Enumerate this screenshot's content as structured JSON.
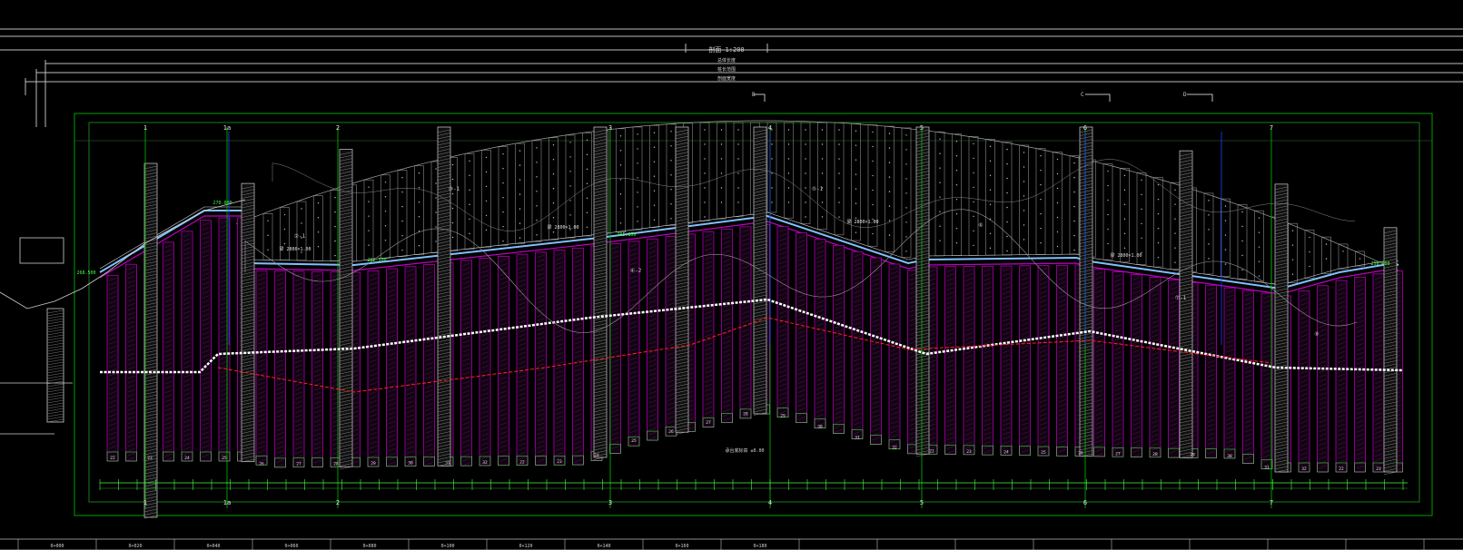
{
  "drawing": {
    "title": "剖面 1:200",
    "scale_marks": [
      "总体长度",
      "桩长范围",
      "剖面宽度"
    ],
    "section_marks": [
      "B",
      "C",
      "D"
    ],
    "grid_labels": [
      "1",
      "1a",
      "2",
      "3",
      "4",
      "5",
      "6",
      "7"
    ],
    "layer_tags": [
      "②-1",
      "③-1",
      "④-2",
      "⑤-1",
      "⑥",
      "⑦-1",
      "⑨"
    ],
    "elevation_tags": [
      "270.000",
      "262.300",
      "265.850",
      "258.000",
      "268.500"
    ],
    "beam_tags": [
      "梁 2800×1.00",
      "梁 2800×1.00",
      "梁 2800×1.00",
      "梁 2800×1.00"
    ],
    "bottom_note": "承台底标高 ±0.00",
    "station_marks": [
      "0+000",
      "0+020",
      "0+040",
      "0+060",
      "0+080",
      "0+100",
      "0+120",
      "0+140",
      "0+160",
      "0+180"
    ],
    "pile_numbers": [
      "22",
      "23",
      "24",
      "25",
      "26",
      "27",
      "28",
      "29",
      "30",
      "31",
      "32"
    ]
  },
  "colors": {
    "background": "#000000",
    "lines": "#d0d0d0",
    "frame_green": "#00c000",
    "pile_magenta": "#c000c0",
    "cap_cyan": "#80c0ff",
    "dim_green": "#40ff40",
    "red_line": "#ff2020",
    "blue_line": "#2040ff"
  }
}
